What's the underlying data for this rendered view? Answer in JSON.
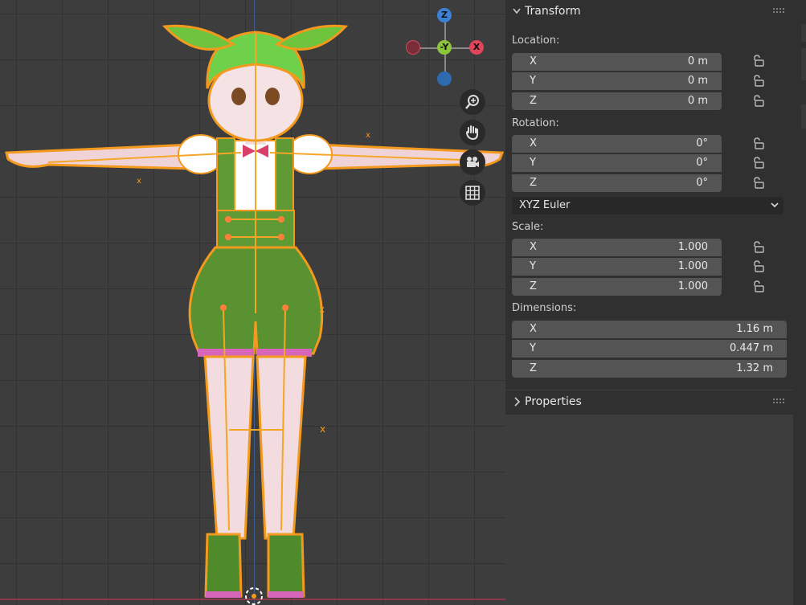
{
  "gizmo": {
    "z_label": "Z",
    "y_label": "-Y",
    "x_label": "X"
  },
  "transform": {
    "title": "Transform",
    "location": {
      "label": "Location:",
      "x": {
        "axis": "X",
        "value": "0 m"
      },
      "y": {
        "axis": "Y",
        "value": "0 m"
      },
      "z": {
        "axis": "Z",
        "value": "0 m"
      }
    },
    "rotation": {
      "label": "Rotation:",
      "x": {
        "axis": "X",
        "value": "0°"
      },
      "y": {
        "axis": "Y",
        "value": "0°"
      },
      "z": {
        "axis": "Z",
        "value": "0°"
      }
    },
    "rotation_mode": "XYZ Euler",
    "scale": {
      "label": "Scale:",
      "x": {
        "axis": "X",
        "value": "1.000"
      },
      "y": {
        "axis": "Y",
        "value": "1.000"
      },
      "z": {
        "axis": "Z",
        "value": "1.000"
      }
    },
    "dimensions": {
      "label": "Dimensions:",
      "x": {
        "axis": "X",
        "value": "1.16 m"
      },
      "y": {
        "axis": "Y",
        "value": "0.447 m"
      },
      "z": {
        "axis": "Z",
        "value": "1.32 m"
      }
    }
  },
  "properties": {
    "title": "Properties"
  },
  "colors": {
    "axis_x": "#e0455a",
    "axis_y": "#8cc43a",
    "axis_z": "#3b82d6",
    "selection_outline": "#f39a1e",
    "panel_bg": "#303030",
    "field_bg": "#545454"
  }
}
